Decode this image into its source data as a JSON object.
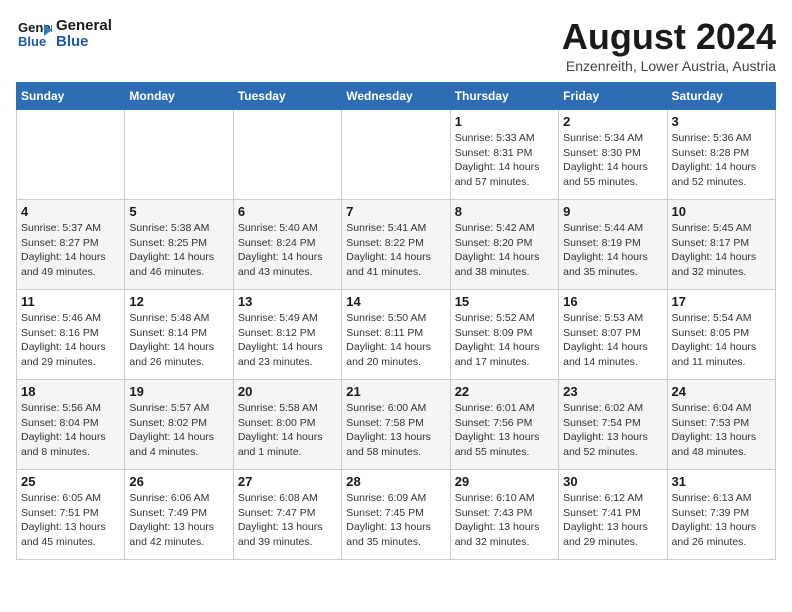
{
  "header": {
    "logo_line1": "General",
    "logo_line2": "Blue",
    "title": "August 2024",
    "subtitle": "Enzenreith, Lower Austria, Austria"
  },
  "weekdays": [
    "Sunday",
    "Monday",
    "Tuesday",
    "Wednesday",
    "Thursday",
    "Friday",
    "Saturday"
  ],
  "weeks": [
    [
      {
        "day": "",
        "detail": ""
      },
      {
        "day": "",
        "detail": ""
      },
      {
        "day": "",
        "detail": ""
      },
      {
        "day": "",
        "detail": ""
      },
      {
        "day": "1",
        "detail": "Sunrise: 5:33 AM\nSunset: 8:31 PM\nDaylight: 14 hours\nand 57 minutes."
      },
      {
        "day": "2",
        "detail": "Sunrise: 5:34 AM\nSunset: 8:30 PM\nDaylight: 14 hours\nand 55 minutes."
      },
      {
        "day": "3",
        "detail": "Sunrise: 5:36 AM\nSunset: 8:28 PM\nDaylight: 14 hours\nand 52 minutes."
      }
    ],
    [
      {
        "day": "4",
        "detail": "Sunrise: 5:37 AM\nSunset: 8:27 PM\nDaylight: 14 hours\nand 49 minutes."
      },
      {
        "day": "5",
        "detail": "Sunrise: 5:38 AM\nSunset: 8:25 PM\nDaylight: 14 hours\nand 46 minutes."
      },
      {
        "day": "6",
        "detail": "Sunrise: 5:40 AM\nSunset: 8:24 PM\nDaylight: 14 hours\nand 43 minutes."
      },
      {
        "day": "7",
        "detail": "Sunrise: 5:41 AM\nSunset: 8:22 PM\nDaylight: 14 hours\nand 41 minutes."
      },
      {
        "day": "8",
        "detail": "Sunrise: 5:42 AM\nSunset: 8:20 PM\nDaylight: 14 hours\nand 38 minutes."
      },
      {
        "day": "9",
        "detail": "Sunrise: 5:44 AM\nSunset: 8:19 PM\nDaylight: 14 hours\nand 35 minutes."
      },
      {
        "day": "10",
        "detail": "Sunrise: 5:45 AM\nSunset: 8:17 PM\nDaylight: 14 hours\nand 32 minutes."
      }
    ],
    [
      {
        "day": "11",
        "detail": "Sunrise: 5:46 AM\nSunset: 8:16 PM\nDaylight: 14 hours\nand 29 minutes."
      },
      {
        "day": "12",
        "detail": "Sunrise: 5:48 AM\nSunset: 8:14 PM\nDaylight: 14 hours\nand 26 minutes."
      },
      {
        "day": "13",
        "detail": "Sunrise: 5:49 AM\nSunset: 8:12 PM\nDaylight: 14 hours\nand 23 minutes."
      },
      {
        "day": "14",
        "detail": "Sunrise: 5:50 AM\nSunset: 8:11 PM\nDaylight: 14 hours\nand 20 minutes."
      },
      {
        "day": "15",
        "detail": "Sunrise: 5:52 AM\nSunset: 8:09 PM\nDaylight: 14 hours\nand 17 minutes."
      },
      {
        "day": "16",
        "detail": "Sunrise: 5:53 AM\nSunset: 8:07 PM\nDaylight: 14 hours\nand 14 minutes."
      },
      {
        "day": "17",
        "detail": "Sunrise: 5:54 AM\nSunset: 8:05 PM\nDaylight: 14 hours\nand 11 minutes."
      }
    ],
    [
      {
        "day": "18",
        "detail": "Sunrise: 5:56 AM\nSunset: 8:04 PM\nDaylight: 14 hours\nand 8 minutes."
      },
      {
        "day": "19",
        "detail": "Sunrise: 5:57 AM\nSunset: 8:02 PM\nDaylight: 14 hours\nand 4 minutes."
      },
      {
        "day": "20",
        "detail": "Sunrise: 5:58 AM\nSunset: 8:00 PM\nDaylight: 14 hours\nand 1 minute."
      },
      {
        "day": "21",
        "detail": "Sunrise: 6:00 AM\nSunset: 7:58 PM\nDaylight: 13 hours\nand 58 minutes."
      },
      {
        "day": "22",
        "detail": "Sunrise: 6:01 AM\nSunset: 7:56 PM\nDaylight: 13 hours\nand 55 minutes."
      },
      {
        "day": "23",
        "detail": "Sunrise: 6:02 AM\nSunset: 7:54 PM\nDaylight: 13 hours\nand 52 minutes."
      },
      {
        "day": "24",
        "detail": "Sunrise: 6:04 AM\nSunset: 7:53 PM\nDaylight: 13 hours\nand 48 minutes."
      }
    ],
    [
      {
        "day": "25",
        "detail": "Sunrise: 6:05 AM\nSunset: 7:51 PM\nDaylight: 13 hours\nand 45 minutes."
      },
      {
        "day": "26",
        "detail": "Sunrise: 6:06 AM\nSunset: 7:49 PM\nDaylight: 13 hours\nand 42 minutes."
      },
      {
        "day": "27",
        "detail": "Sunrise: 6:08 AM\nSunset: 7:47 PM\nDaylight: 13 hours\nand 39 minutes."
      },
      {
        "day": "28",
        "detail": "Sunrise: 6:09 AM\nSunset: 7:45 PM\nDaylight: 13 hours\nand 35 minutes."
      },
      {
        "day": "29",
        "detail": "Sunrise: 6:10 AM\nSunset: 7:43 PM\nDaylight: 13 hours\nand 32 minutes."
      },
      {
        "day": "30",
        "detail": "Sunrise: 6:12 AM\nSunset: 7:41 PM\nDaylight: 13 hours\nand 29 minutes."
      },
      {
        "day": "31",
        "detail": "Sunrise: 6:13 AM\nSunset: 7:39 PM\nDaylight: 13 hours\nand 26 minutes."
      }
    ]
  ]
}
